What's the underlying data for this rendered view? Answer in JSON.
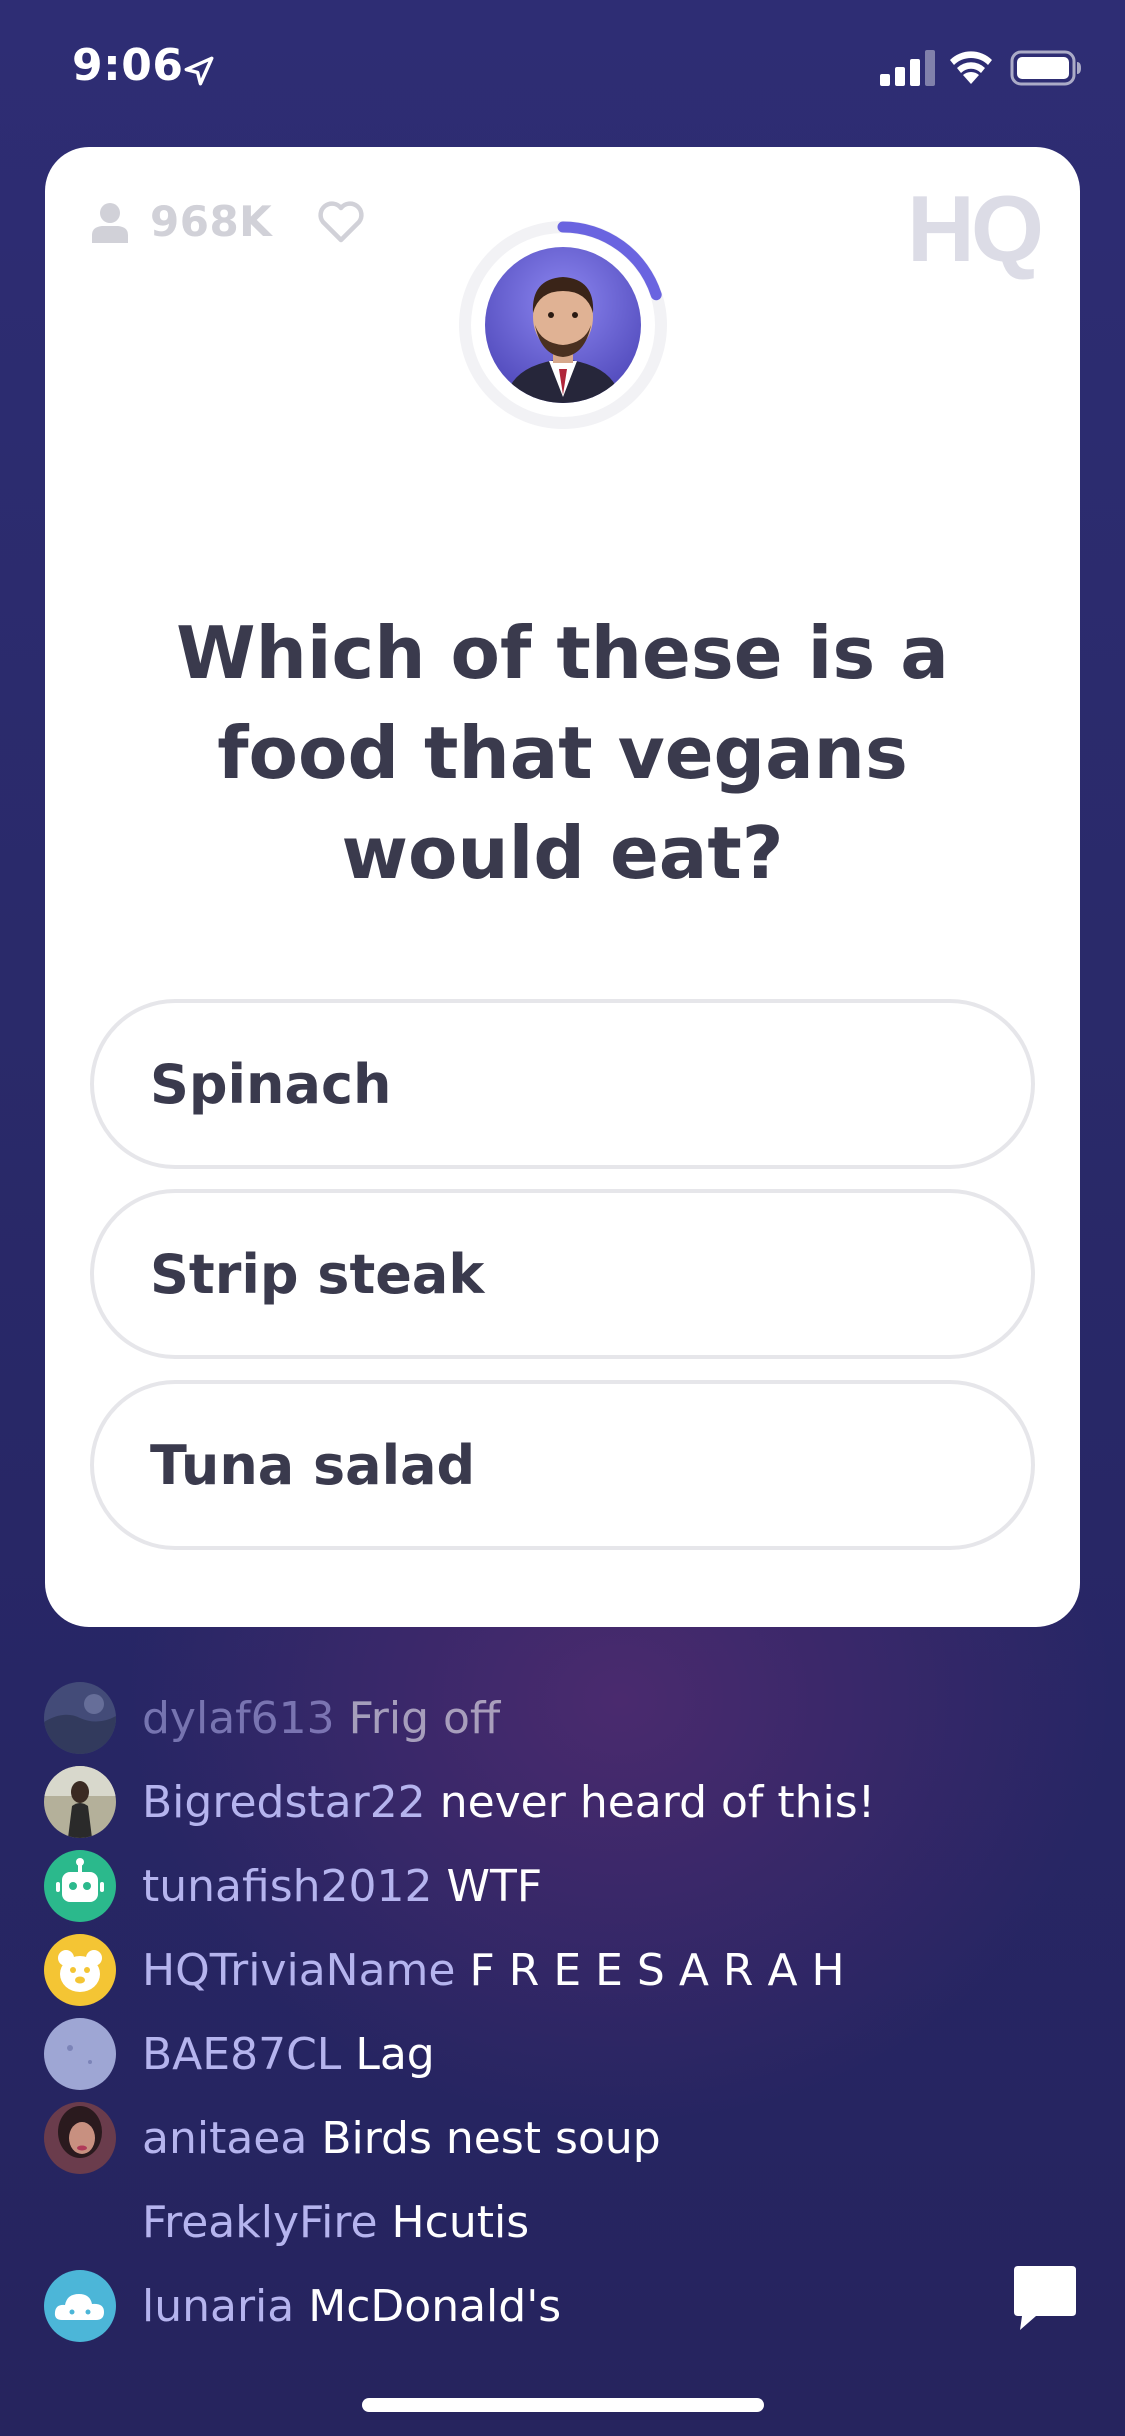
{
  "status_bar": {
    "time": "9:06",
    "icons": [
      "location-arrow-icon",
      "cellular-signal-icon",
      "wifi-icon",
      "battery-icon"
    ]
  },
  "card": {
    "viewer_count": "968K",
    "logo": "HQ",
    "question": "Which of these is a food that vegans would eat?",
    "answers": [
      {
        "label": "Spinach"
      },
      {
        "label": "Strip steak"
      },
      {
        "label": "Tuna salad"
      }
    ],
    "timer_progress": 0.2
  },
  "chat": {
    "messages": [
      {
        "user": "dylaf613",
        "text": "Frig off"
      },
      {
        "user": "Bigredstar22",
        "text": "never heard of this!"
      },
      {
        "user": "tunafish2012",
        "text": "WTF"
      },
      {
        "user": "HQTriviaName",
        "text": "F R E E S A R A H"
      },
      {
        "user": "BAE87CL",
        "text": "Lag"
      },
      {
        "user": "anitaea",
        "text": "Birds nest soup"
      },
      {
        "user": "FreaklyFire",
        "text": "Hcutis"
      },
      {
        "user": "lunaria",
        "text": "McDonald's"
      }
    ]
  },
  "colors": {
    "background": "#2b2a6c",
    "accent": "#6a64e0",
    "username": "#b5b4ee",
    "card_text": "#3a3a4d"
  }
}
